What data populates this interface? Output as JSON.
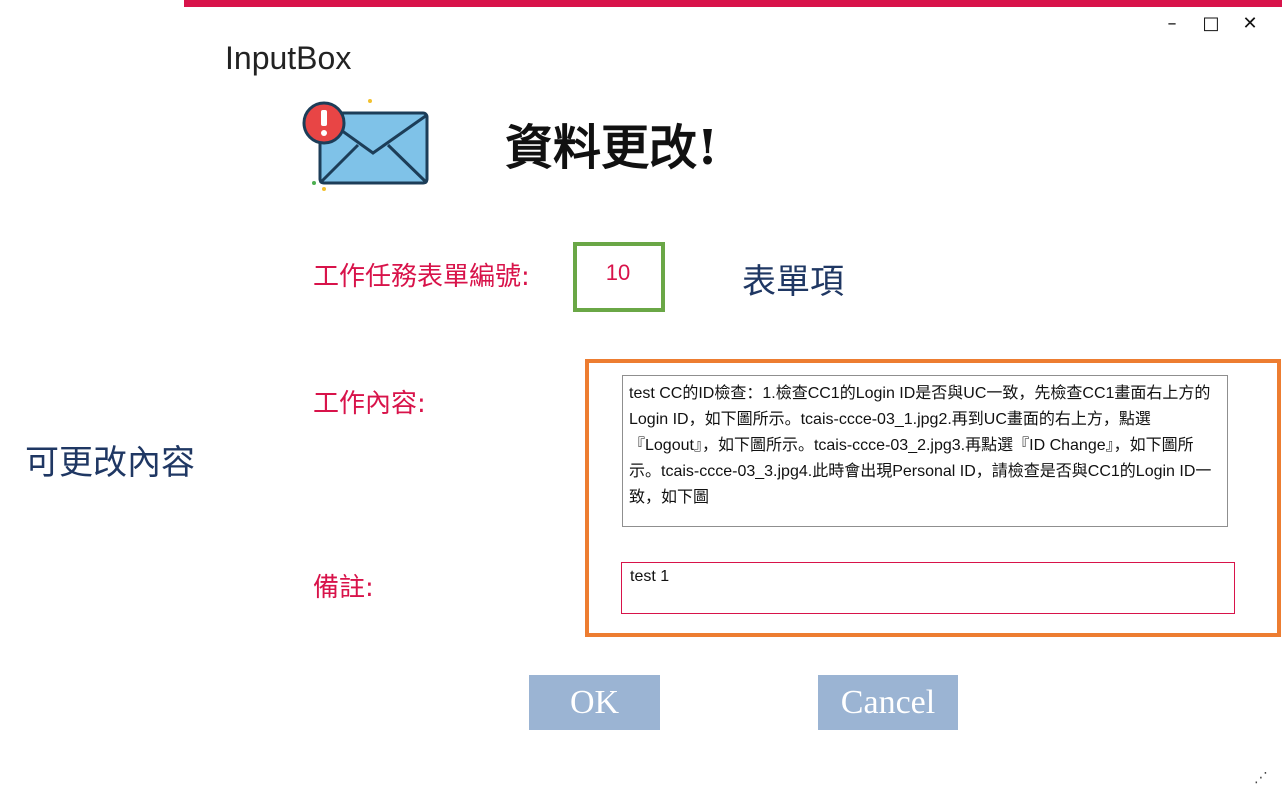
{
  "window": {
    "title": "InputBox",
    "controls": {
      "minimize": "–",
      "maximize": "□",
      "close": "✕"
    }
  },
  "dialog": {
    "icon": "envelope-alert-icon",
    "heading": "資料更改!",
    "form_number_label": "工作任務表單編號:",
    "form_number_value": "10",
    "content_label": "工作內容:",
    "content_value": "test CC的ID檢查：1.檢查CC1的Login ID是否與UC一致，先檢查CC1畫面右上方的Login ID，如下圖所示。tcais-ccce-03_1.jpg2.再到UC畫面的右上方，點選『Logout』，如下圖所示。tcais-ccce-03_2.jpg3.再點選『ID Change』，如下圖所示。tcais-ccce-03_3.jpg4.此時會出現Personal ID，請檢查是否與CC1的Login ID一致，如下圖",
    "remark_label": "備註:",
    "remark_value": "test 1",
    "ok_label": "OK",
    "cancel_label": "Cancel"
  },
  "annotations": {
    "form_item": "表單項",
    "editable_content": "可更改內容"
  },
  "colors": {
    "accent": "#d8134a",
    "button": "#9bb4d3",
    "annotation_green": "#6aa746",
    "annotation_orange": "#ed7d31",
    "annotation_text": "#1f3763"
  }
}
